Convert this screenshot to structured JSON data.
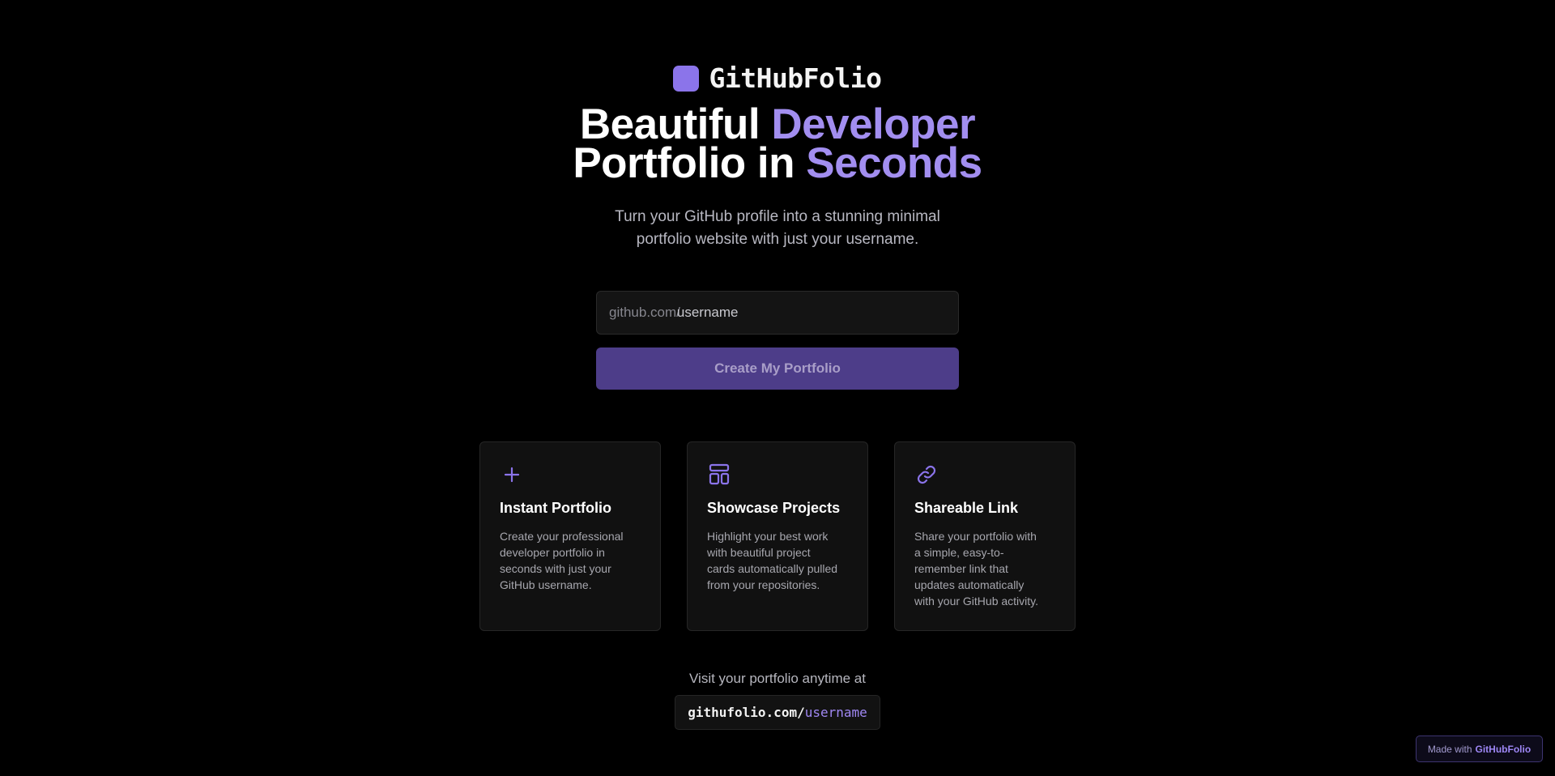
{
  "brand": {
    "name": "GitHubFolio",
    "logo_color": "#8b74ea"
  },
  "hero": {
    "line1_white": "Beautiful",
    "line1_accent": "Developer",
    "line2_white": "Portfolio in",
    "line2_accent": "Seconds"
  },
  "subtitle": {
    "line1": "Turn your GitHub profile into a stunning minimal",
    "line2": "portfolio website with just your username."
  },
  "form": {
    "prefix": "github.com/",
    "placeholder": "username",
    "value": "",
    "submit_label": "Create My Portfolio"
  },
  "features": [
    {
      "icon": "plus-icon",
      "title": "Instant Portfolio",
      "desc_lines": [
        "Create your professional",
        "developer portfolio in",
        "seconds with just your",
        "GitHub username."
      ]
    },
    {
      "icon": "layout-icon",
      "title": "Showcase Projects",
      "desc_lines": [
        "Highlight your best work",
        "with beautiful project",
        "cards automatically pulled",
        "from your repositories."
      ]
    },
    {
      "icon": "link-icon",
      "title": "Shareable Link",
      "desc_lines": [
        "Share your portfolio with",
        "a simple, easy-to-",
        "remember link that",
        "updates automatically",
        "with your GitHub activity."
      ]
    }
  ],
  "footer": {
    "visit_text": "Visit your portfolio anytime at",
    "url_base": "githufolio.com/",
    "url_user": "username"
  },
  "badge": {
    "prefix": "Made with",
    "brand": "GitHubFolio"
  },
  "colors": {
    "accent": "#a28ef0",
    "button_bg": "#4d3d89",
    "background": "#000000"
  }
}
